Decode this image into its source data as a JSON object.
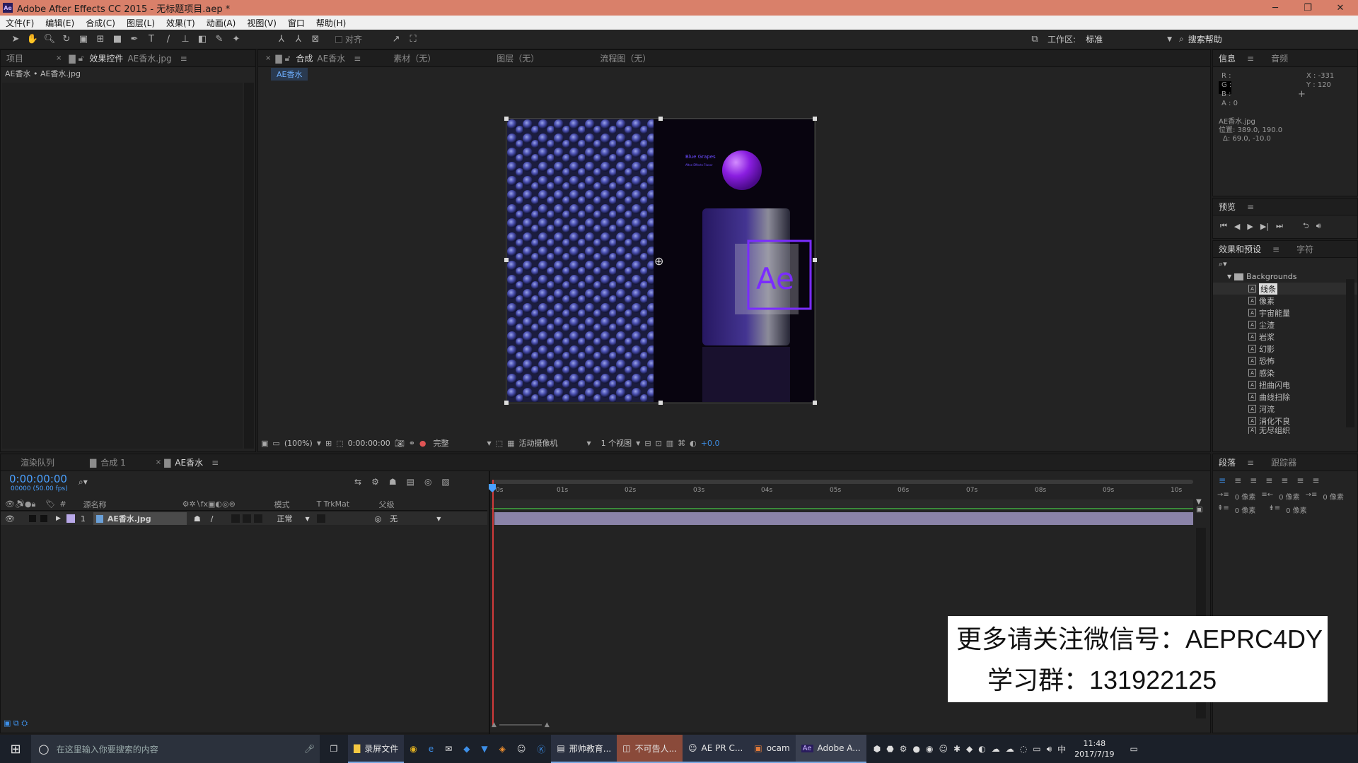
{
  "window": {
    "title": "Adobe After Effects CC 2015 - 无标题项目.aep *",
    "logo": "Ae"
  },
  "menu": [
    "文件(F)",
    "编辑(E)",
    "合成(C)",
    "图层(L)",
    "效果(T)",
    "动画(A)",
    "视图(V)",
    "窗口",
    "帮助(H)"
  ],
  "toolbar": {
    "align_label": "对齐",
    "workspace_label": "工作区:",
    "workspace_value": "标准",
    "search_help": "搜索帮助"
  },
  "project_panel": {
    "tab_project": "项目",
    "tab_effects": "效果控件",
    "tab_effects_file": "AE香水.jpg",
    "breadcrumb": "AE香水 • AE香水.jpg"
  },
  "viewer": {
    "tab_comp": "合成",
    "tab_comp_name": "AE香水",
    "tab_footage": "素材（无）",
    "tab_layer": "图层（无）",
    "tab_flowchart": "流程图（无）",
    "comp_chip": "AE香水",
    "zoom": "(100%)",
    "time": "0:00:00:00",
    "quality": "完整",
    "camera": "活动摄像机",
    "views": "1 个视图",
    "exposure": "+0.0",
    "image_text_title": "Blue Grapes",
    "image_text_sub": "Aftse Effects Flavor",
    "bottle_logo": "Ae"
  },
  "info_panel": {
    "tab_info": "信息",
    "tab_audio": "音频",
    "r": "R :",
    "g": "G :",
    "b": "B :",
    "a": "A : 0",
    "x": "X : -331",
    "y": "Y : 120",
    "file": "AE香水.jpg",
    "position": "位置: 389.0, 190.0",
    "delta": "Δ: 69.0, -10.0"
  },
  "preview_panel": {
    "title": "预览"
  },
  "effects_panel": {
    "tab_effects": "效果和预设",
    "tab_char": "字符",
    "folder": "Backgrounds",
    "items": [
      "线条",
      "像素",
      "宇宙能量",
      "尘渣",
      "岩浆",
      "幻影",
      "恐怖",
      "感染",
      "扭曲闪电",
      "曲线扫除",
      "河流",
      "消化不良",
      "无尽组织"
    ]
  },
  "paragraph_panel": {
    "tab_para": "段落",
    "tab_tracker": "跟踪器",
    "px1": "0 像素",
    "px2": "0 像素",
    "px3": "0 像素",
    "px4": "0 像素",
    "px5": "0 像素"
  },
  "timeline": {
    "tab_render": "渲染队列",
    "tab_comp1": "合成 1",
    "tab_ae": "AE香水",
    "timecode": "0:00:00:00",
    "fps": "00000 (50.00 fps)",
    "col_hash": "#",
    "col_source": "源名称",
    "col_mode": "模式",
    "col_t": "T",
    "col_trkmat": "TrkMat",
    "col_parent": "父级",
    "layer_num": "1",
    "layer_name": "AE香水.jpg",
    "layer_mode": "正常",
    "layer_parent": "无",
    "ruler": [
      "0s",
      "01s",
      "02s",
      "03s",
      "04s",
      "05s",
      "06s",
      "07s",
      "08s",
      "09s",
      "10s"
    ]
  },
  "watermark": {
    "line1": "更多请关注微信号：AEPRC4DY",
    "line2": "学习群：131922125"
  },
  "taskbar": {
    "search_placeholder": "在这里输入你要搜索的内容",
    "apps": [
      "录屏文件",
      "邢帅教育...",
      "不可告人...",
      "AE PR C...",
      "ocam",
      "Adobe A..."
    ],
    "time": "11:48",
    "date": "2017/7/19",
    "ime": "中"
  }
}
